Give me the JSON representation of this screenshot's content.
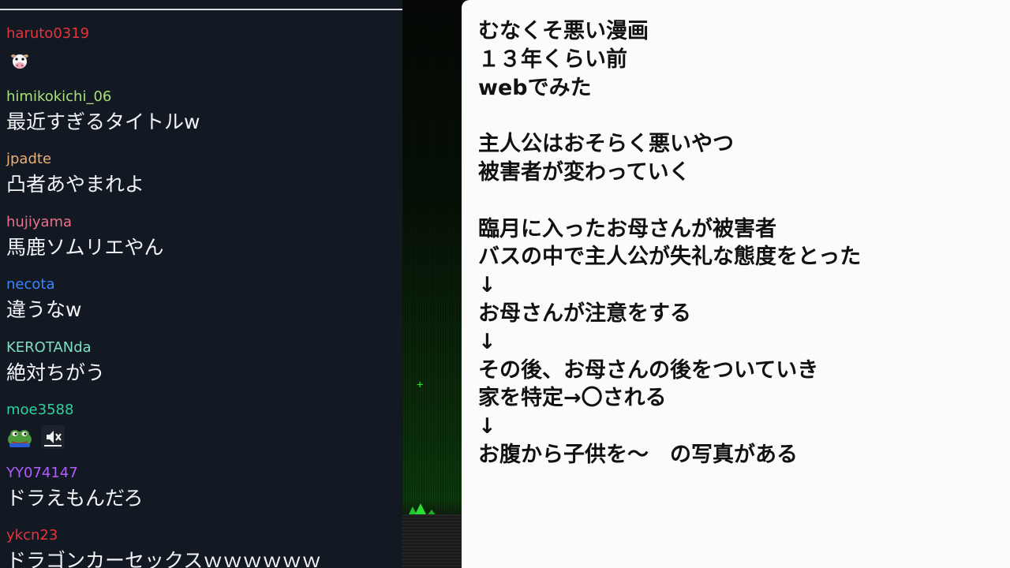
{
  "chat": {
    "messages": [
      {
        "user": "haruto0319",
        "user_color": "#e5343f",
        "text": "",
        "emotes": [
          "cow-emote"
        ]
      },
      {
        "user": "himikokichi_06",
        "user_color": "#a8e07a",
        "text": "最近すぎるタイトルw",
        "emotes": []
      },
      {
        "user": "jpadte",
        "user_color": "#e9b07a",
        "text": "凸者あやまれよ",
        "emotes": []
      },
      {
        "user": "hujiyama",
        "user_color": "#ef6f8c",
        "text": "馬鹿ソムリエやん",
        "emotes": []
      },
      {
        "user": "necota",
        "user_color": "#3a86ff",
        "text": "違うなw",
        "emotes": []
      },
      {
        "user": "KEROTANda",
        "user_color": "#7fe0c0",
        "text": "絶対ちがう",
        "emotes": []
      },
      {
        "user": "moe3588",
        "user_color": "#30d0a0",
        "text": "",
        "emotes": [
          "frog-emote",
          "mute-emote"
        ]
      },
      {
        "user": "YY074147",
        "user_color": "#b15cff",
        "text": "ドラえもんだろ",
        "emotes": []
      },
      {
        "user": "ykcn23",
        "user_color": "#e5343f",
        "text": "ドラゴンカーセックスｗｗｗｗｗｗ",
        "emotes": []
      }
    ]
  },
  "notes": {
    "lines": [
      "むなくそ悪い漫画",
      "１３年くらい前",
      "webでみた",
      "",
      "主人公はおそらく悪いやつ",
      "被害者が変わっていく",
      "",
      "臨月に入ったお母さんが被害者",
      "バスの中で主人公が失礼な態度をとった",
      "↓",
      "お母さんが注意をする",
      "↓",
      "その後、お母さんの後をついていき",
      "家を特定→〇される",
      "↓",
      "お腹から子供を～　の写真がある"
    ]
  },
  "game": {
    "marker": "+"
  },
  "colors": {
    "chat_bg": "#121922",
    "chat_text": "#f2f4f6",
    "notes_bg": "#fbfbfb",
    "game_green": "#2fdc2f"
  }
}
